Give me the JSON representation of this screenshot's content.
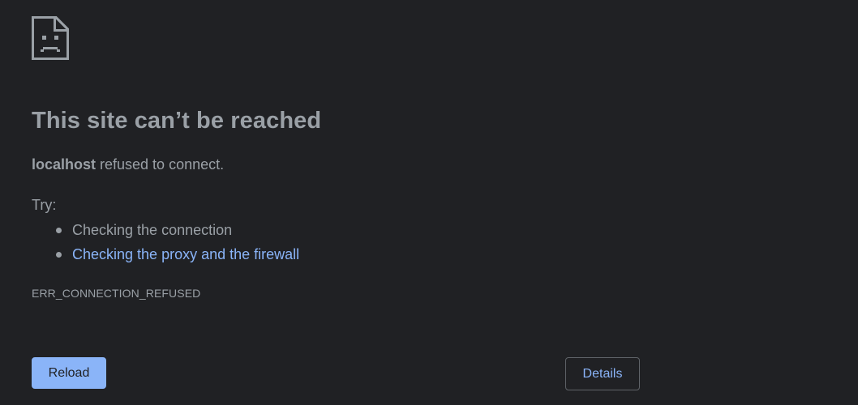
{
  "icon": {
    "name": "sad-page-icon"
  },
  "heading": "This site can’t be reached",
  "summary": {
    "host": "localhost",
    "message": " refused to connect."
  },
  "suggestions": {
    "label": "Try:",
    "items": [
      {
        "text": "Checking the connection",
        "is_link": false
      },
      {
        "text": "Checking the proxy and the firewall",
        "is_link": true
      }
    ]
  },
  "error_code": "ERR_CONNECTION_REFUSED",
  "buttons": {
    "reload": "Reload",
    "details": "Details"
  },
  "colors": {
    "background": "#202124",
    "text": "#9aa0a6",
    "link": "#8ab4f8",
    "primary_button": "#8ab4f8",
    "button_border": "#5f6368"
  }
}
